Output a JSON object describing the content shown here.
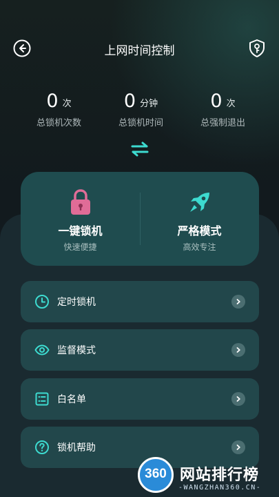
{
  "header": {
    "title": "上网时间控制",
    "back_icon": "back-arrow-icon",
    "shield_icon": "shield-key-icon"
  },
  "stats": [
    {
      "value": "0",
      "unit": "次",
      "label": "总锁机次数"
    },
    {
      "value": "0",
      "unit": "分钟",
      "label": "总锁机时间"
    },
    {
      "value": "0",
      "unit": "次",
      "label": "总强制退出"
    }
  ],
  "modes": {
    "one_key": {
      "title": "一键锁机",
      "subtitle": "快速便捷",
      "icon": "lock-icon"
    },
    "strict": {
      "title": "严格模式",
      "subtitle": "高效专注",
      "icon": "rocket-icon"
    }
  },
  "list": [
    {
      "label": "定时锁机",
      "icon": "clock-icon"
    },
    {
      "label": "监督模式",
      "icon": "eye-icon"
    },
    {
      "label": "白名单",
      "icon": "list-icon"
    },
    {
      "label": "锁机帮助",
      "icon": "help-icon"
    }
  ],
  "watermark": {
    "number": "360",
    "text": "网站排行榜",
    "sub": "-WANGZHAN360.CN-"
  },
  "colors": {
    "accent": "#3ddbd0",
    "card": "#1f4c4f",
    "list_item": "#22474b",
    "lock_pink": "#e06c97",
    "background": "#141c20"
  }
}
